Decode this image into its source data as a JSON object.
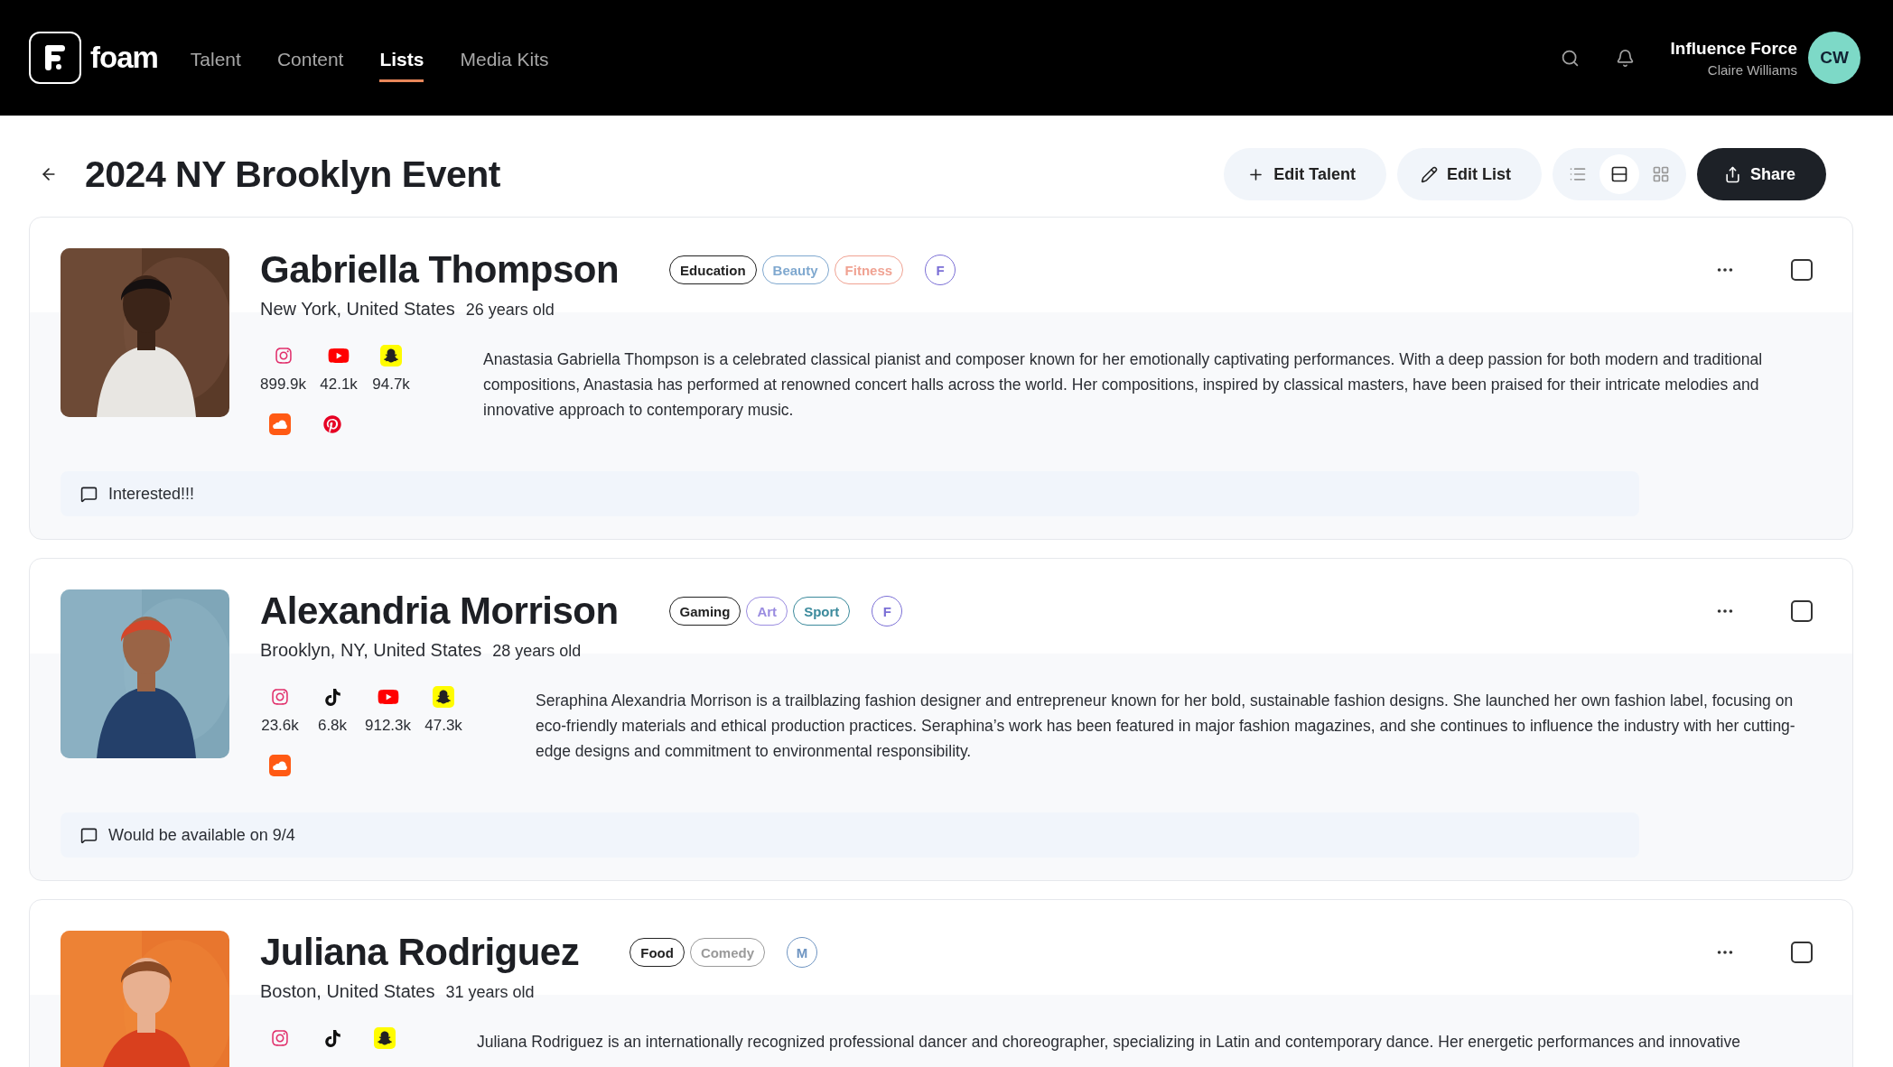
{
  "header": {
    "brand": "foam",
    "nav": [
      {
        "label": "Talent",
        "selected": false
      },
      {
        "label": "Content",
        "selected": false
      },
      {
        "label": "Lists",
        "selected": true
      },
      {
        "label": "Media Kits",
        "selected": false
      }
    ],
    "account": {
      "org": "Influence Force",
      "user": "Claire Williams",
      "initials": "CW"
    }
  },
  "page": {
    "title": "2024 NY Brooklyn Event",
    "actions": [
      {
        "kind": "add",
        "label": "Edit Talent"
      },
      {
        "kind": "edit",
        "label": "Edit List"
      }
    ],
    "views": [
      {
        "kind": "list",
        "selected": false
      },
      {
        "kind": "rows",
        "selected": true
      },
      {
        "kind": "grid",
        "selected": false
      }
    ],
    "share": "Share"
  },
  "talents": [
    {
      "name": "Gabriella Thompson",
      "location": "New York, United States",
      "age": "26 years old",
      "photo": {
        "kind": "picture"
      },
      "checked": false,
      "tags": [
        {
          "label": "Education",
          "color": "#222222"
        },
        {
          "label": "Beauty",
          "color": "#7fa8cf"
        },
        {
          "label": "Fitness",
          "color": "#f0a292"
        }
      ],
      "gender": {
        "label": "F",
        "color": "#7b6fd6"
      },
      "socials": [
        {
          "kind": "instagram",
          "count": "899.9k"
        },
        {
          "kind": "youtube",
          "count": "42.1k"
        },
        {
          "kind": "snapchat",
          "count": "94.7k"
        }
      ],
      "extra_socials": [
        {
          "kind": "soundcloud"
        },
        {
          "kind": "pinterest"
        }
      ],
      "bio": "Anastasia Gabriella Thompson is a celebrated classical pianist and composer known for her emotionally captivating performances. With a deep passion for both modern and traditional compositions, Anastasia has performed at renowned concert halls across the world. Her compositions, inspired by classical masters, have been praised for their intricate melodies and innovative approach to contemporary music.",
      "note": "Interested!!!"
    },
    {
      "name": "Alexandria Morrison",
      "location": "Brooklyn, NY, United States",
      "age": "28 years old",
      "photo": {
        "kind": "picture"
      },
      "checked": false,
      "tags": [
        {
          "label": "Gaming",
          "color": "#222222"
        },
        {
          "label": "Art",
          "color": "#9a8ce0"
        },
        {
          "label": "Sport",
          "color": "#3b8a9c"
        }
      ],
      "gender": {
        "label": "F",
        "color": "#7b6fd6"
      },
      "socials": [
        {
          "kind": "instagram",
          "count": "23.6k"
        },
        {
          "kind": "tiktok",
          "count": "6.8k"
        },
        {
          "kind": "youtube",
          "count": "912.3k"
        },
        {
          "kind": "snapchat",
          "count": "47.3k"
        }
      ],
      "extra_socials": [
        {
          "kind": "soundcloud"
        }
      ],
      "bio": "Seraphina Alexandria Morrison is a trailblazing fashion designer and entrepreneur known for her bold, sustainable fashion designs. She launched her own fashion label, focusing on eco-friendly materials and ethical production practices. Seraphina’s work has been featured in major fashion magazines, and she continues to influence the industry with her cutting-edge designs and commitment to environmental responsibility.",
      "note": "Would be available on 9/4"
    },
    {
      "name": "Juliana Rodriguez",
      "location": "Boston, United States",
      "age": "31 years old",
      "photo": {
        "kind": "picture"
      },
      "checked": false,
      "tags": [
        {
          "label": "Food",
          "color": "#222222"
        },
        {
          "label": "Comedy",
          "color": "#9a9a9a"
        }
      ],
      "gender": {
        "label": "M",
        "color": "#6f95c2"
      },
      "socials": [
        {
          "kind": "instagram"
        },
        {
          "kind": "tiktok"
        },
        {
          "kind": "snapchat"
        }
      ],
      "bio": "Juliana Rodriguez is an internationally recognized professional dancer and choreographer, specializing in Latin and contemporary dance. Her energetic performances and innovative"
    }
  ]
}
